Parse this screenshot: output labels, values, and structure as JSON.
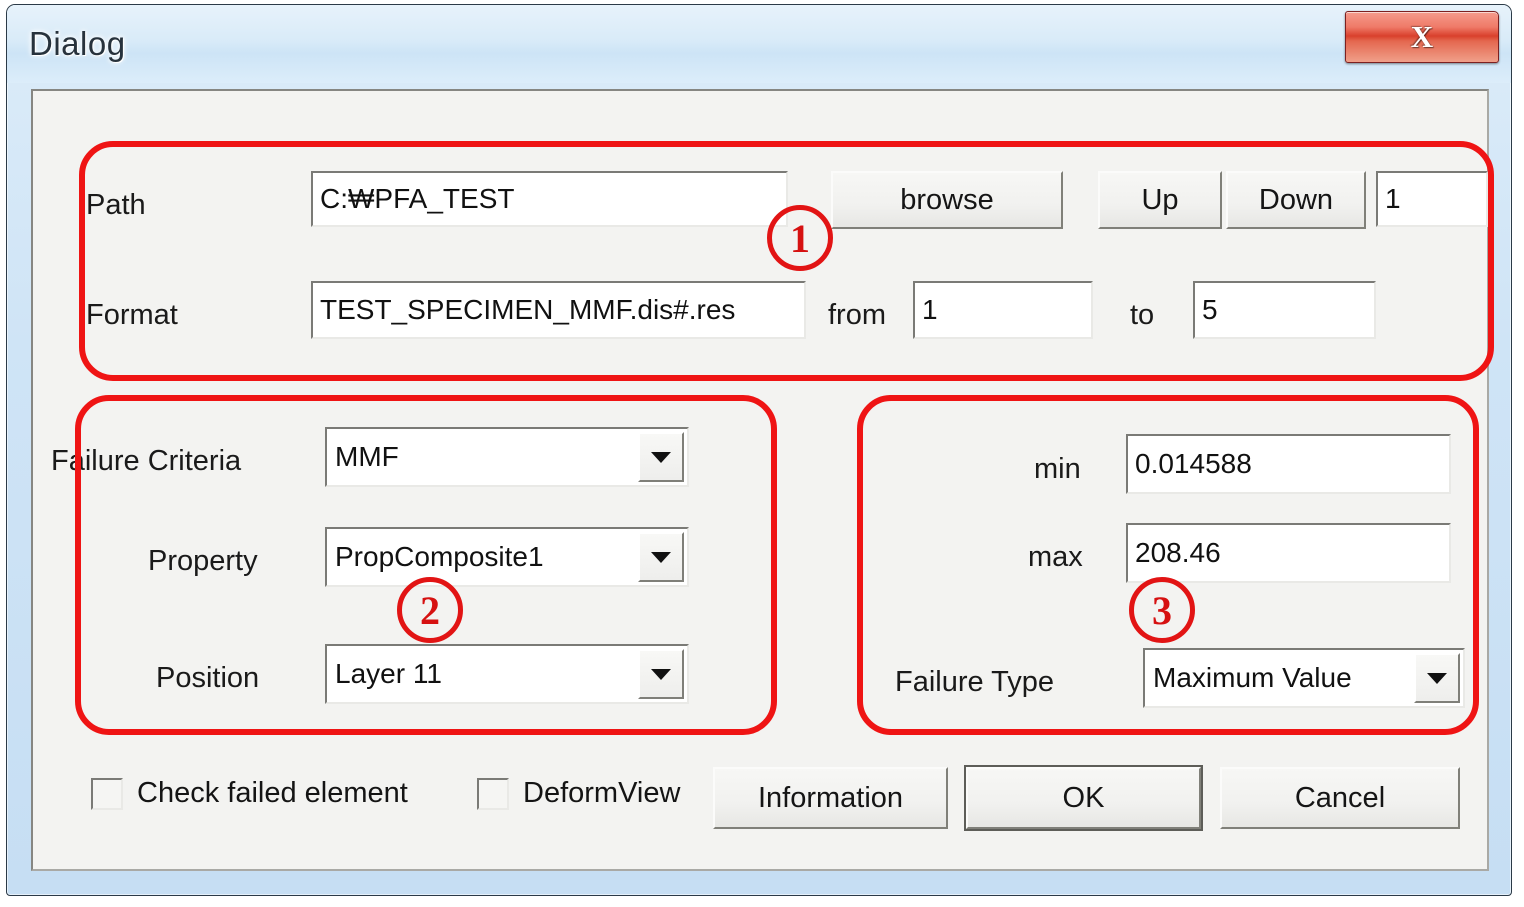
{
  "window": {
    "title": "Dialog",
    "close_icon": "close-x-icon",
    "close_label": "X",
    "accent_red": "#ef1414",
    "titlebar_blue": "#d9ebf8",
    "client_gray": "#f3f3f1"
  },
  "file_section": {
    "path_label": "Path",
    "path_value": "C:₩PFA_TEST",
    "browse_label": "browse",
    "up_label": "Up",
    "down_label": "Down",
    "step_value": "1",
    "format_label": "Format",
    "format_value": "TEST_SPECIMEN_MMF.dis#.res",
    "from_label": "from",
    "from_value": "1",
    "to_label": "to",
    "to_value": "5"
  },
  "criteria_section": {
    "failure_criteria_label": "Failure Criteria",
    "failure_criteria_value": "MMF",
    "property_label": "Property",
    "property_value": "PropComposite1",
    "position_label": "Position",
    "position_value": "Layer 11",
    "dropdown_icon": "chevron-down-icon"
  },
  "range_section": {
    "min_label": "min",
    "min_value": "0.014588",
    "max_label": "max",
    "max_value": "208.46",
    "failure_type_label": "Failure Type",
    "failure_type_value": "Maximum Value",
    "dropdown_icon": "chevron-down-icon"
  },
  "footer": {
    "check_failed_element_label": "Check failed element",
    "check_failed_element_checked": false,
    "deform_view_label": "DeformView",
    "deform_view_checked": false,
    "information_label": "Information",
    "ok_label": "OK",
    "cancel_label": "Cancel"
  },
  "annotations": {
    "marker_1": "1",
    "marker_2": "2",
    "marker_3": "3"
  }
}
